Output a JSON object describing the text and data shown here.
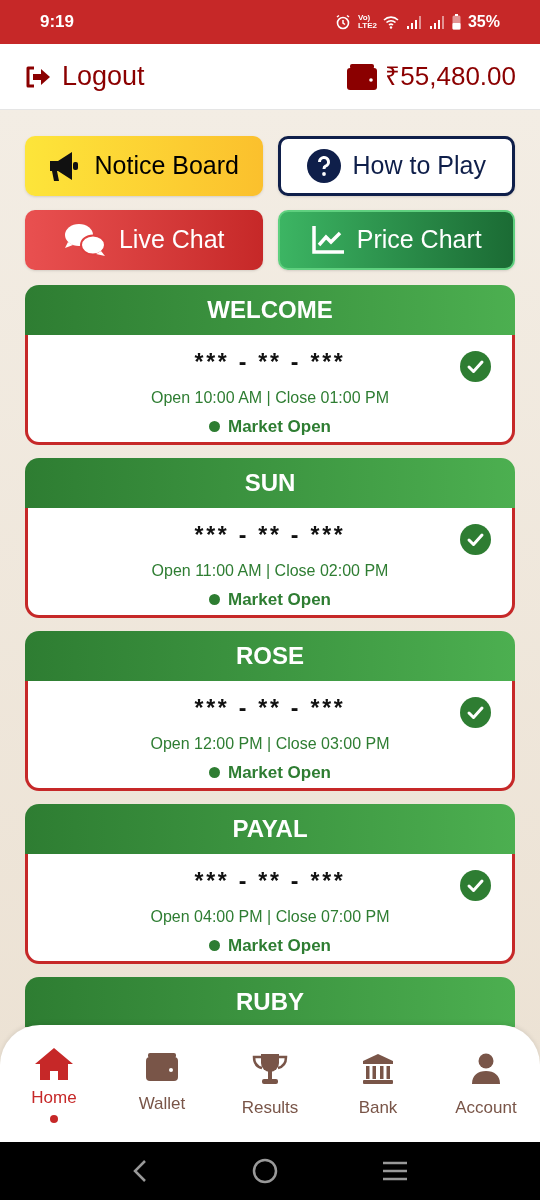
{
  "status_bar": {
    "time": "9:19",
    "network_label": "Vo) LTE2",
    "battery": "35%"
  },
  "header": {
    "logout": "Logout",
    "balance": "₹55,480.00"
  },
  "actions": [
    {
      "kind": "notice",
      "label": "Notice Board"
    },
    {
      "kind": "help",
      "label": "How to Play"
    },
    {
      "kind": "chat",
      "label": "Live Chat"
    },
    {
      "kind": "chart",
      "label": "Price Chart"
    }
  ],
  "markets": [
    {
      "name": "WELCOME",
      "result": "*** - ** - ***",
      "timing": "Open 10:00 AM | Close 01:00 PM",
      "status": "Market Open",
      "open": true
    },
    {
      "name": "SUN",
      "result": "*** - ** - ***",
      "timing": "Open 11:00 AM | Close 02:00 PM",
      "status": "Market Open",
      "open": true
    },
    {
      "name": "ROSE",
      "result": "*** - ** - ***",
      "timing": "Open 12:00 PM | Close 03:00 PM",
      "status": "Market Open",
      "open": true
    },
    {
      "name": "PAYAL",
      "result": "*** - ** - ***",
      "timing": "Open 04:00 PM | Close 07:00 PM",
      "status": "Market Open",
      "open": true
    },
    {
      "name": "RUBY"
    }
  ],
  "bottom_nav": [
    {
      "kind": "home",
      "label": "Home",
      "selected": true
    },
    {
      "kind": "wallet",
      "label": "Wallet",
      "selected": false
    },
    {
      "kind": "results",
      "label": "Results",
      "selected": false
    },
    {
      "kind": "bank",
      "label": "Bank",
      "selected": false
    },
    {
      "kind": "account",
      "label": "Account",
      "selected": false
    }
  ]
}
